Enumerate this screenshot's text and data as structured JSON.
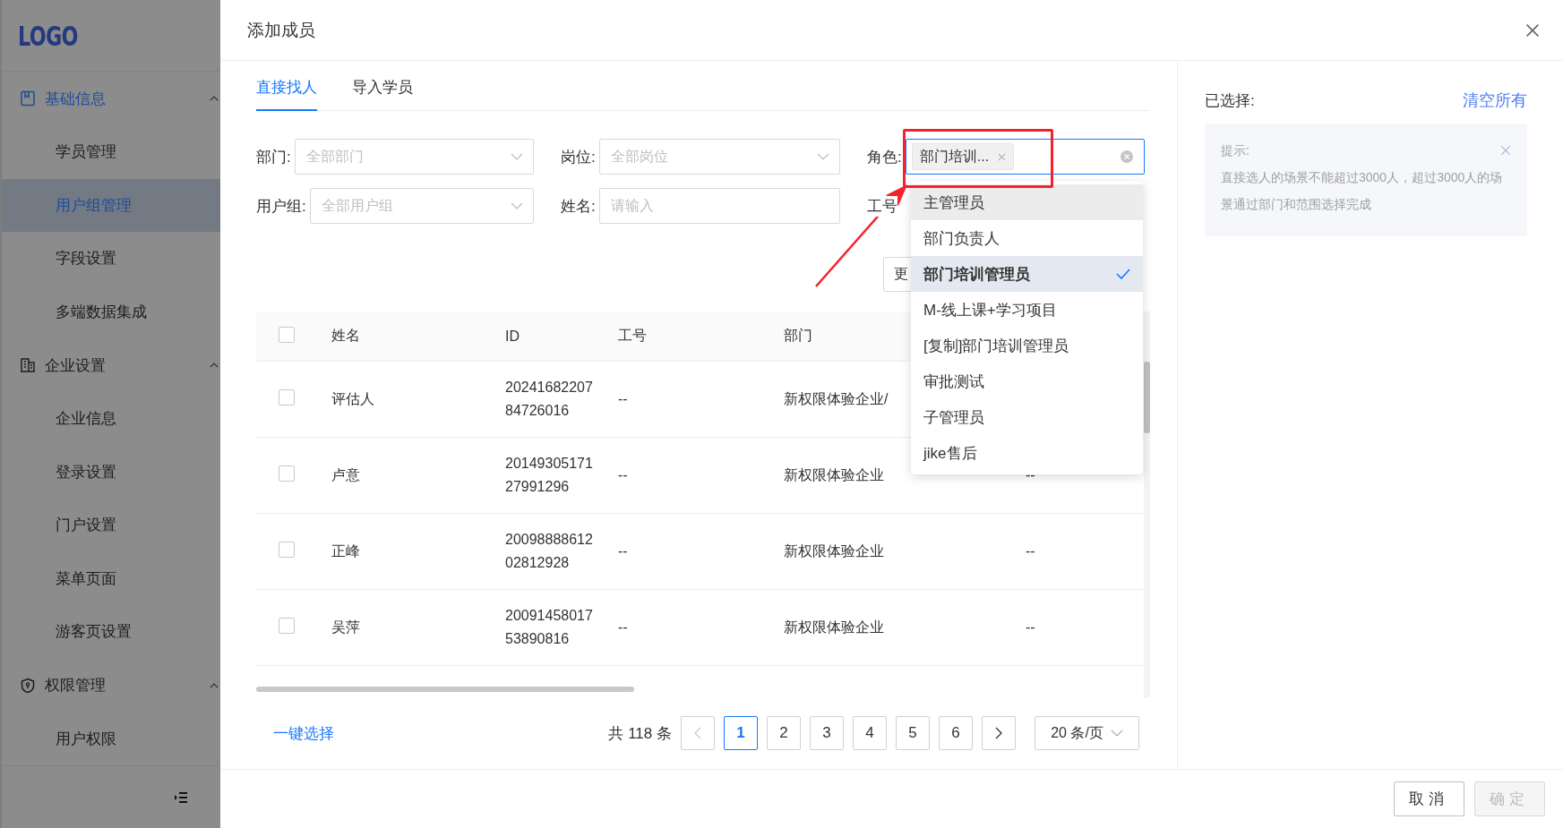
{
  "sidebar": {
    "logo": "LOGO",
    "groups": [
      {
        "label": "基础信息",
        "active": true,
        "expanded": true,
        "items": [
          {
            "label": "学员管理",
            "selected": false
          },
          {
            "label": "用户组管理",
            "selected": true
          },
          {
            "label": "字段设置",
            "selected": false
          },
          {
            "label": "多端数据集成",
            "selected": false
          }
        ]
      },
      {
        "label": "企业设置",
        "active": false,
        "expanded": true,
        "items": [
          {
            "label": "企业信息",
            "selected": false
          },
          {
            "label": "登录设置",
            "selected": false
          },
          {
            "label": "门户设置",
            "selected": false
          },
          {
            "label": "菜单页面",
            "selected": false
          },
          {
            "label": "游客页设置",
            "selected": false
          }
        ]
      },
      {
        "label": "权限管理",
        "active": false,
        "expanded": true,
        "items": [
          {
            "label": "用户权限",
            "selected": false
          }
        ]
      }
    ]
  },
  "dialog": {
    "title": "添加成员",
    "tabs": [
      {
        "label": "直接找人",
        "selected": true
      },
      {
        "label": "导入学员",
        "selected": false
      }
    ],
    "filters": [
      {
        "label": "部门:",
        "kind": "select",
        "placeholder": "全部部门"
      },
      {
        "label": "岗位:",
        "kind": "select",
        "placeholder": "全部岗位"
      },
      {
        "label": "角色:",
        "kind": "tags",
        "focused": true,
        "tags": [
          "部门培训..."
        ]
      },
      {
        "label": "用户组:",
        "kind": "select",
        "placeholder": "全部用户组"
      },
      {
        "label": "姓名:",
        "kind": "input",
        "placeholder": "请输入"
      },
      {
        "label": "工号",
        "kind": "covered"
      }
    ],
    "more_button": "更",
    "role_dropdown": {
      "options": [
        {
          "label": "主管理员",
          "selected": false,
          "hovered": true
        },
        {
          "label": "部门负责人",
          "selected": false,
          "hovered": false
        },
        {
          "label": "部门培训管理员",
          "selected": true,
          "hovered": false
        },
        {
          "label": "M-线上课+学习项目",
          "selected": false,
          "hovered": false
        },
        {
          "label": "[复制]部门培训管理员",
          "selected": false,
          "hovered": false
        },
        {
          "label": "审批测试",
          "selected": false,
          "hovered": false
        },
        {
          "label": "子管理员",
          "selected": false,
          "hovered": false
        },
        {
          "label": "jike售后",
          "selected": false,
          "hovered": false
        }
      ]
    },
    "table": {
      "header_checked": false,
      "columns": [
        "姓名",
        "ID",
        "工号",
        "部门"
      ],
      "rows": [
        {
          "checked": false,
          "name": "评估人",
          "id": "2024168220784726016",
          "employee_no": "--",
          "department": "新权限体验企业/"
        },
        {
          "checked": false,
          "name": "卢意",
          "id": "2014930517127991296",
          "employee_no": "--",
          "department": "新权限体验企业",
          "column_5": "--"
        },
        {
          "checked": false,
          "name": "正峰",
          "id": "2009888861202812928",
          "employee_no": "--",
          "department": "新权限体验企业",
          "column_5": "--"
        },
        {
          "checked": false,
          "name": "吴萍",
          "id": "2009145801753890816",
          "employee_no": "--",
          "department": "新权限体验企业",
          "column_5": "--"
        }
      ]
    },
    "select_all_link": "一键选择",
    "pagination": {
      "total": "共 118 条",
      "prev_disabled": true,
      "next_disabled": false,
      "pages": [
        {
          "label": "1",
          "selected": true
        },
        {
          "label": "2",
          "selected": false
        },
        {
          "label": "3",
          "selected": false
        },
        {
          "label": "4",
          "selected": false
        },
        {
          "label": "5",
          "selected": false
        },
        {
          "label": "6",
          "selected": false
        }
      ],
      "page_size": "20 条/页"
    },
    "selection": {
      "label": "已选择:",
      "clear_all": "清空所有",
      "tip": {
        "title": "提示:",
        "text": "直接选人的场景不能超过3000人，超过3000人的场景通过部门和范围选择完成"
      }
    },
    "buttons": [
      {
        "label": "取消",
        "disabled": false
      },
      {
        "label": "确定",
        "disabled": true
      }
    ]
  }
}
